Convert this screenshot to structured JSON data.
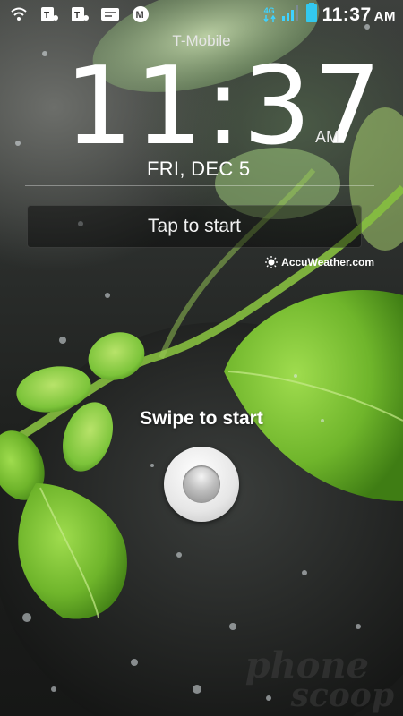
{
  "status_bar": {
    "network_label": "4G",
    "time": "11:37",
    "ampm": "AM",
    "notification_icons": [
      "shield-icon",
      "tmobile-app-icon",
      "tmobile-app-icon",
      "message-icon",
      "mail-icon"
    ]
  },
  "lockscreen": {
    "carrier": "T-Mobile",
    "time": "11:37",
    "ampm": "AM",
    "date": "FRI, DEC 5",
    "tap_to_start": "Tap to start",
    "weather_provider": "AccuWeather.com",
    "swipe_to_start": "Swipe to start"
  },
  "watermark": {
    "line1": "phone",
    "line2": "scoop"
  },
  "colors": {
    "network_accent": "#3fd2ff",
    "battery": "#33c9ee",
    "leaf_green": "#7cc43a"
  }
}
